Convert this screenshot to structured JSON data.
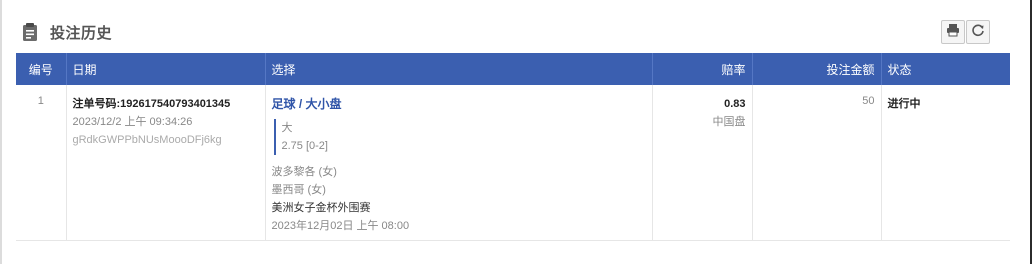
{
  "header": {
    "title": "投注历史",
    "icon": "clipboard-icon"
  },
  "toolbar": {
    "print_icon": "printer-icon",
    "refresh_icon": "refresh-icon"
  },
  "table": {
    "columns": {
      "id": "编号",
      "date": "日期",
      "selection": "选择",
      "odds": "赔率",
      "stake": "投注金额",
      "status": "状态"
    },
    "rows": [
      {
        "id": "1",
        "order_label": "注单号码:192617540793401345",
        "datetime": "2023/12/2 上午 09:34:26",
        "ref": "gRdkGWPPbNUsMoooDFj6kg",
        "market": "足球 / 大小盘",
        "pick": "大",
        "line": "2.75 [0-2]",
        "home": "波多黎各 (女)",
        "away": "墨西哥 (女)",
        "league": "美洲女子金杯外围赛",
        "match_time": "2023年12月02日 上午 08:00",
        "odds": "0.83",
        "odds_type": "中国盘",
        "stake": "50",
        "status": "进行中"
      }
    ]
  }
}
